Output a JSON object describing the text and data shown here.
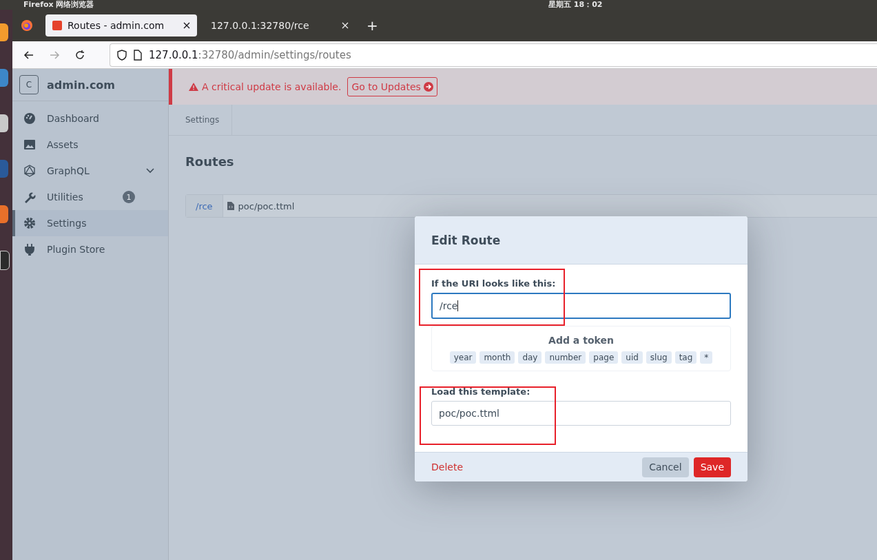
{
  "system_bar": {
    "app_menu": "Firefox 网络浏览器",
    "clock": "星期五 18：02"
  },
  "browser": {
    "tabs": [
      {
        "title": "Routes - admin.com",
        "selected": true
      },
      {
        "title": "127.0.0.1:32780/rce",
        "selected": false
      }
    ],
    "new_tab": "+",
    "url_host": "127.0.0.1",
    "url_rest": ":32780/admin/settings/routes"
  },
  "sidebar": {
    "site_initial": "C",
    "site_name": "admin.com",
    "items": [
      {
        "label": "Dashboard",
        "selected": false
      },
      {
        "label": "Assets",
        "selected": false
      },
      {
        "label": "GraphQL",
        "selected": false,
        "expandable": true
      },
      {
        "label": "Utilities",
        "selected": false,
        "badge": "1"
      },
      {
        "label": "Settings",
        "selected": true
      },
      {
        "label": "Plugin Store",
        "selected": false
      }
    ]
  },
  "alert": {
    "message": "A critical update is available.",
    "button": "Go to Updates"
  },
  "breadcrumb": [
    "Settings"
  ],
  "page_title": "Routes",
  "routes": [
    {
      "uri": "/rce",
      "template": "poc/poc.ttml"
    }
  ],
  "modal": {
    "title": "Edit Route",
    "uri_label": "If the URI looks like this:",
    "uri_value": "/rce",
    "token_title": "Add a token",
    "tokens": [
      "year",
      "month",
      "day",
      "number",
      "page",
      "uid",
      "slug",
      "tag",
      "*"
    ],
    "template_label": "Load this template:",
    "template_value": "poc/poc.ttml",
    "delete": "Delete",
    "cancel": "Cancel",
    "save": "Save"
  }
}
